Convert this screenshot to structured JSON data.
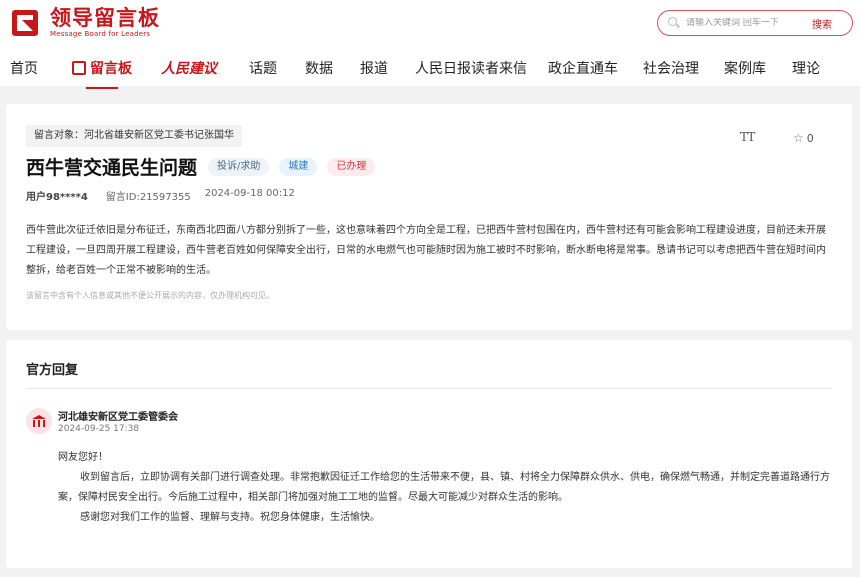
{
  "header": {
    "logo_title": "领导留言板",
    "logo_subtitle": "Message Board for Leaders",
    "search_placeholder": "请输入关键词 回车一下",
    "search_button": "搜索"
  },
  "nav": [
    {
      "label": "首页"
    },
    {
      "label": "留言板"
    },
    {
      "label": "人民建议"
    },
    {
      "label": "话题"
    },
    {
      "label": "数据"
    },
    {
      "label": "报道"
    },
    {
      "label": "人民日报读者来信"
    },
    {
      "label": "政企直通车"
    },
    {
      "label": "社会治理"
    },
    {
      "label": "案例库"
    },
    {
      "label": "理论"
    }
  ],
  "message": {
    "target": "留言对象：河北省雄安新区党工委书记张国华",
    "font_toggle": "TT",
    "fav_count": "0",
    "title": "西牛营交通民生问题",
    "badge_type": "投诉/求助",
    "badge_domain": "城建",
    "badge_status": "已办理",
    "user": "用户98****4",
    "message_id": "留言ID:21597355",
    "datetime": "2024-09-18 00:12",
    "content": "西牛营此次征迁依旧是分布征迁，东南西北四面八方都分别拆了一些，这也意味着四个方向全是工程，已把西牛营村包围在内，西牛营村还有可能会影响工程建设进度，目前还未开展工程建设，一旦四周开展工程建设，西牛营老百姓如何保障安全出行，日常的水电燃气也可能随时因为施工被时不时影响，断水断电将是常事。恳请书记可以考虑把西牛营在短时间内整拆，给老百姓一个正常不被影响的生活。",
    "notice": "该留言中含有个人信息或其他不便公开展示的内容，仅办理机构可见。"
  },
  "reply": {
    "heading": "官方回复",
    "org": "河北雄安新区党工委管委会",
    "time": "2024-09-25 17:38",
    "greeting": "网友您好！",
    "para1": "收到留言后，立即协调有关部门进行调查处理。非常抱歉因征迁工作给您的生活带来不便，县、镇、村将全力保障群众供水、供电，确保燃气畅通，并制定完善道路通行方案，保障村民安全出行。今后施工过程中，相关部门将加强对施工工地的监督。尽最大可能减少对群众生活的影响。",
    "para2": "感谢您对我们工作的监督、理解与支持。祝您身体健康，生活愉快。"
  }
}
